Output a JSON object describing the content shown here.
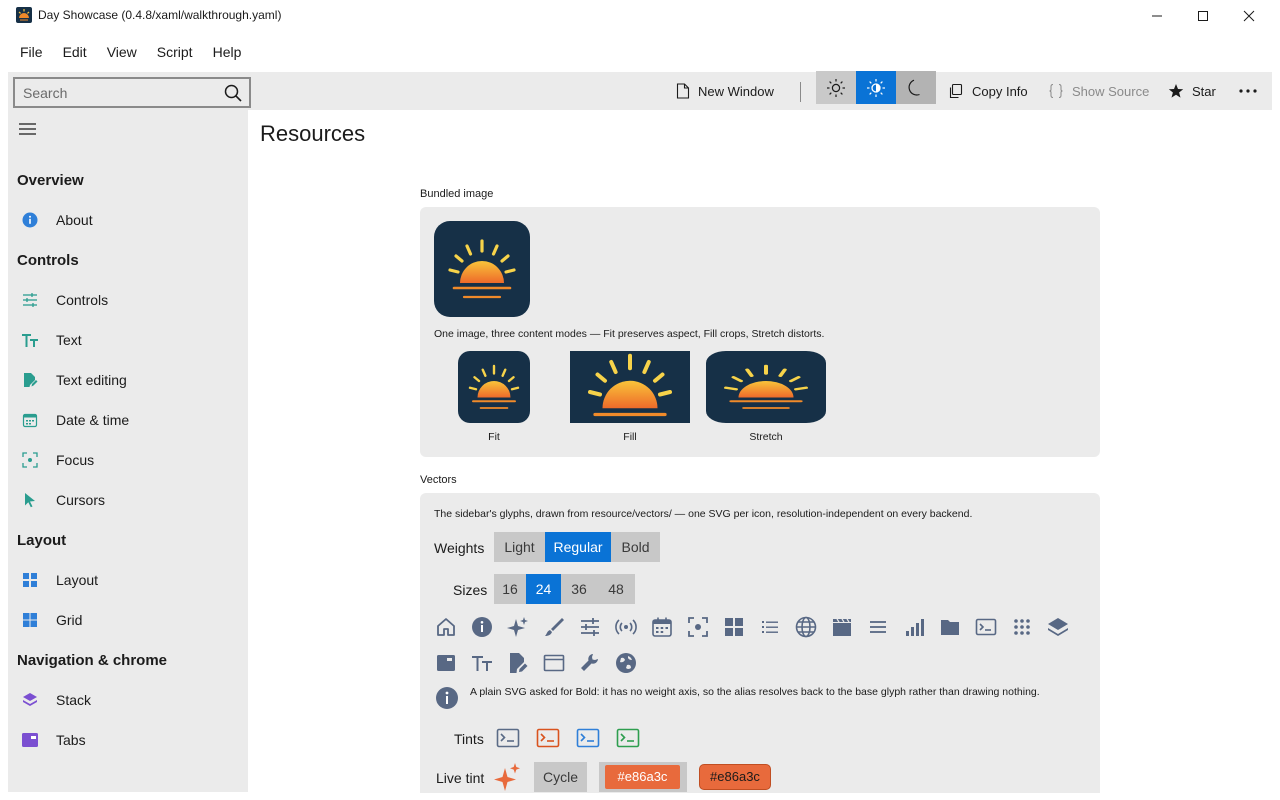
{
  "window": {
    "title": "Day Showcase (0.4.8/xaml/walkthrough.yaml)"
  },
  "menu": [
    "File",
    "Edit",
    "View",
    "Script",
    "Help"
  ],
  "toolbar": {
    "search_placeholder": "Search",
    "new_window": "New Window",
    "copy_info": "Copy Info",
    "show_source": "Show Source",
    "star": "Star",
    "theme_selected": "auto"
  },
  "sidebar": {
    "groups": [
      {
        "title": "Overview",
        "items": [
          {
            "label": "About",
            "icon": "info-icon"
          }
        ]
      },
      {
        "title": "Controls",
        "items": [
          {
            "label": "Controls",
            "icon": "sliders-icon"
          },
          {
            "label": "Text",
            "icon": "text-icon"
          },
          {
            "label": "Text editing",
            "icon": "document-edit-icon"
          },
          {
            "label": "Date & time",
            "icon": "calendar-icon"
          },
          {
            "label": "Focus",
            "icon": "focus-icon"
          },
          {
            "label": "Cursors",
            "icon": "cursor-icon"
          }
        ]
      },
      {
        "title": "Layout",
        "items": [
          {
            "label": "Layout",
            "icon": "layout-icon"
          },
          {
            "label": "Grid",
            "icon": "grid-icon"
          }
        ]
      },
      {
        "title": "Navigation & chrome",
        "items": [
          {
            "label": "Stack",
            "icon": "stack-icon"
          },
          {
            "label": "Tabs",
            "icon": "tabs-icon"
          }
        ]
      }
    ]
  },
  "main": {
    "title": "Resources",
    "bundled": {
      "label": "Bundled image",
      "description": "One image, three content modes — Fit preserves aspect, Fill crops, Stretch distorts.",
      "modes": [
        "Fit",
        "Fill",
        "Stretch"
      ]
    },
    "vectors": {
      "label": "Vectors",
      "description": "The sidebar's glyphs, drawn from resource/vectors/ — one SVG per icon, resolution-independent on every backend.",
      "weights_label": "Weights",
      "weights": [
        "Light",
        "Regular",
        "Bold"
      ],
      "weight_selected": "Regular",
      "sizes_label": "Sizes",
      "sizes": [
        "16",
        "24",
        "36",
        "48"
      ],
      "size_selected": "24",
      "glyphs": [
        "home-icon",
        "info-icon",
        "sparkle-icon",
        "brush-icon",
        "sliders-icon",
        "broadcast-icon",
        "calendar-icon",
        "focus-icon",
        "grid-icon",
        "list-icon",
        "globe-icon",
        "film-icon",
        "menu-icon",
        "signal-bars-icon",
        "folder-icon",
        "terminal-icon",
        "dots-grid-icon",
        "stack-icon",
        "tabs-icon",
        "text-icon",
        "document-edit-icon",
        "window-icon",
        "wrench-icon",
        "globe-solid-icon"
      ],
      "note": "A plain SVG asked for Bold: it has no weight axis, so the alias resolves back to the base glyph rather than drawing nothing.",
      "tints_label": "Tints",
      "tint_colors": [
        "#5a6b86",
        "#d9531e",
        "#2f7fd8",
        "#2e9e4f"
      ],
      "live_tint_label": "Live tint",
      "cycle_label": "Cycle",
      "tint_value": "#e86a3c",
      "tint_value_2": "#e86a3c",
      "accent": "#e86a3c"
    }
  }
}
